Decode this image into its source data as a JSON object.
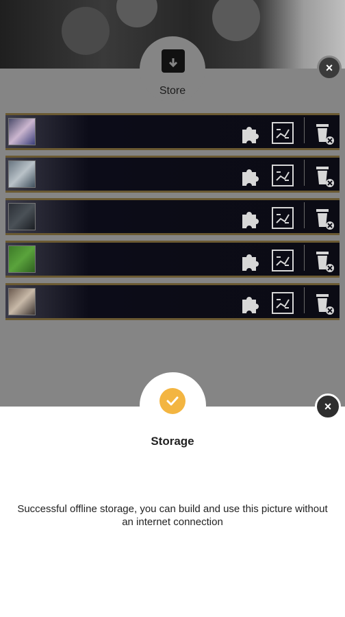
{
  "store": {
    "title": "Store",
    "icon": "archive-download-icon",
    "close_icon": "close-icon",
    "items": [
      {
        "thumb_colors": [
          "#4b4b6a",
          "#cbb6cf",
          "#3b3f7a"
        ]
      },
      {
        "thumb_colors": [
          "#697681",
          "#b9c2c8",
          "#40505c"
        ]
      },
      {
        "thumb_colors": [
          "#2b2f36",
          "#4a5157",
          "#1a1d22"
        ]
      },
      {
        "thumb_colors": [
          "#3d7a28",
          "#5aa33c",
          "#2f6020"
        ]
      },
      {
        "thumb_colors": [
          "#6b5a4f",
          "#c8b9a8",
          "#3c3431"
        ]
      }
    ],
    "row_actions": [
      "puzzle-icon",
      "shuffle-pieces-icon",
      "delete-icon"
    ]
  },
  "dialog": {
    "title": "Storage",
    "message": "Successful offline storage, you can build and use this picture without an internet connection",
    "icon": "check-circle-icon",
    "icon_color": "#f3b541",
    "close_icon": "close-icon"
  }
}
